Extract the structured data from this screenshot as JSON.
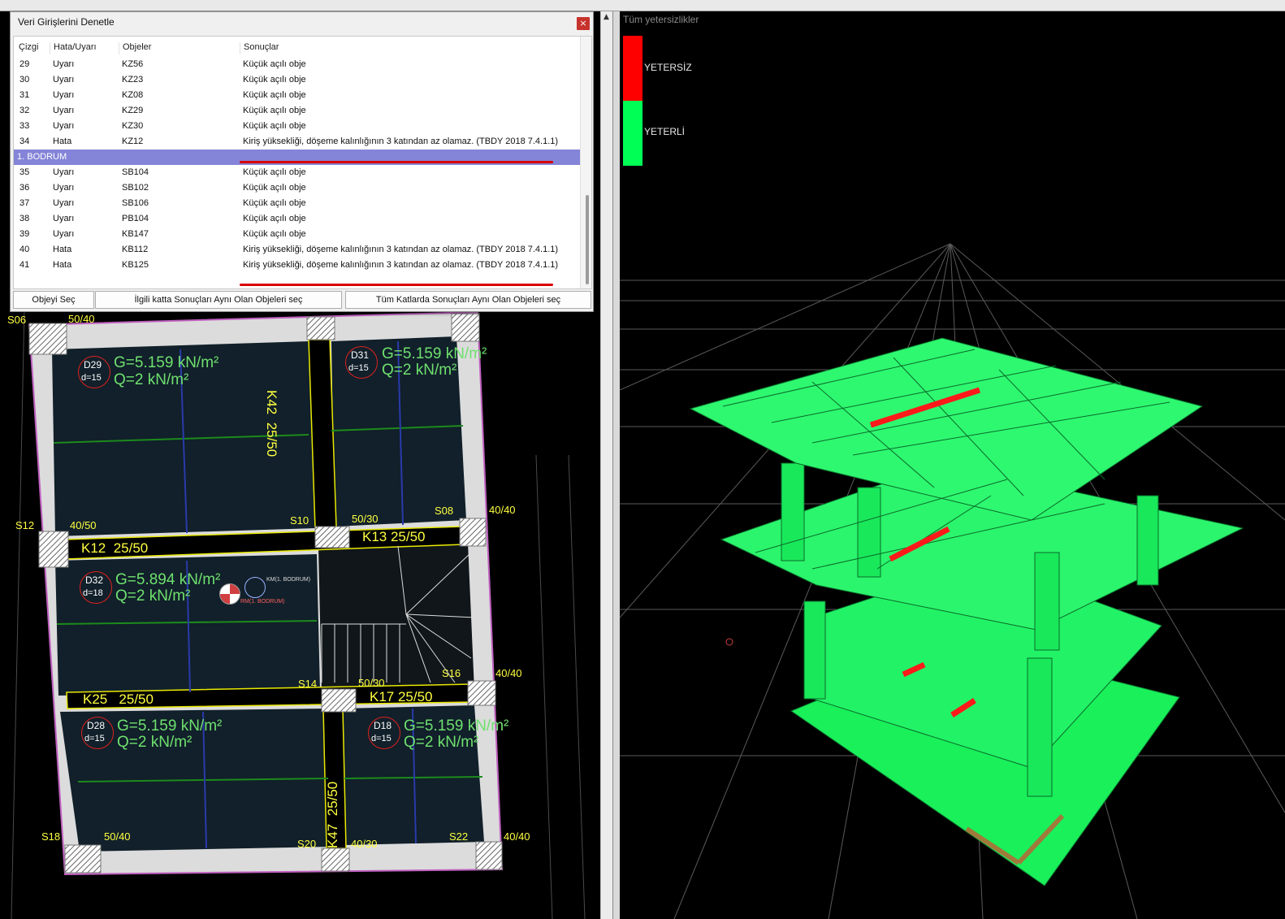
{
  "dialog": {
    "title": "Veri Girişlerini Denetle",
    "close_glyph": "×",
    "columns": [
      "Çizgi",
      "Hata/Uyarı",
      "Objeler",
      "Sonuçlar"
    ],
    "rows": [
      {
        "line": "29",
        "type": "Uyarı",
        "object": "KZ56",
        "result": "Küçük açılı obje"
      },
      {
        "line": "30",
        "type": "Uyarı",
        "object": "KZ23",
        "result": "Küçük açılı obje"
      },
      {
        "line": "31",
        "type": "Uyarı",
        "object": "KZ08",
        "result": "Küçük açılı obje"
      },
      {
        "line": "32",
        "type": "Uyarı",
        "object": "KZ29",
        "result": "Küçük açılı obje"
      },
      {
        "line": "33",
        "type": "Uyarı",
        "object": "KZ30",
        "result": "Küçük açılı obje"
      },
      {
        "line": "34",
        "type": "Hata",
        "object": "KZ12",
        "result": "Kiriş yüksekliği, döşeme kalınlığının 3 katından az olamaz. (TBDY 2018 7.4.1.1)"
      },
      {
        "group": "1. BODRUM"
      },
      {
        "line": "35",
        "type": "Uyarı",
        "object": "SB104",
        "result": "Küçük açılı obje"
      },
      {
        "line": "36",
        "type": "Uyarı",
        "object": "SB102",
        "result": "Küçük açılı obje"
      },
      {
        "line": "37",
        "type": "Uyarı",
        "object": "SB106",
        "result": "Küçük açılı obje"
      },
      {
        "line": "38",
        "type": "Uyarı",
        "object": "PB104",
        "result": "Küçük açılı obje"
      },
      {
        "line": "39",
        "type": "Uyarı",
        "object": "KB147",
        "result": "Küçük açılı obje"
      },
      {
        "line": "40",
        "type": "Hata",
        "object": "KB112",
        "result": "Kiriş yüksekliği, döşeme kalınlığının 3 katından az olamaz. (TBDY 2018 7.4.1.1)"
      },
      {
        "line": "41",
        "type": "Hata",
        "object": "KB125",
        "result": "Kiriş yüksekliği, döşeme kalınlığının 3 katından az olamaz. (TBDY 2018 7.4.1.1)"
      }
    ],
    "buttons": {
      "select_object": "Objeyi Seç",
      "select_same_floor": "İlgili katta Sonuçları Aynı Olan Objeleri seç",
      "select_all_floors": "Tüm Katlarda Sonuçları Aynı Olan Objeleri seç"
    }
  },
  "view3d": {
    "title": "Tüm yetersizlikler",
    "legend": [
      {
        "label": "YETERSİZ",
        "color": "#ff0000"
      },
      {
        "label": "YETERLİ",
        "color": "#00ff55"
      }
    ]
  },
  "plan": {
    "slabs": [
      {
        "id": "D29",
        "d": "d=15",
        "g": "G=5.159 kN/m²",
        "q": "Q=2 kN/m²"
      },
      {
        "id": "D31",
        "d": "d=15",
        "g": "G=5.159 kN/m²",
        "q": "Q=2 kN/m²"
      },
      {
        "id": "D32",
        "d": "d=18",
        "g": "G=5.894 kN/m²",
        "q": "Q=2 kN/m²"
      },
      {
        "id": "D28",
        "d": "d=15",
        "g": "G=5.159 kN/m²",
        "q": "Q=2 kN/m²"
      },
      {
        "id": "D18",
        "d": "d=15",
        "g": "G=5.159 kN/m²",
        "q": "Q=2 kN/m²"
      }
    ],
    "beams": {
      "k12": "K12  25/50",
      "k13": "K13 25/50",
      "k25": "K25   25/50",
      "k17": "K17 25/50",
      "k42": "K42  25/50",
      "k47": "K47  25/50"
    },
    "columns": [
      "S06",
      "S12",
      "S10",
      "S08",
      "S14",
      "S16",
      "S18",
      "S20",
      "S22"
    ],
    "dims": [
      "50/40",
      "40/50",
      "50/30",
      "40/40",
      "50/30",
      "40/40",
      "50/40",
      "40/30",
      "40/40"
    ],
    "km_label": "KM(1. BODRUM)",
    "rm_label": "RM(1. BODRUM)"
  }
}
